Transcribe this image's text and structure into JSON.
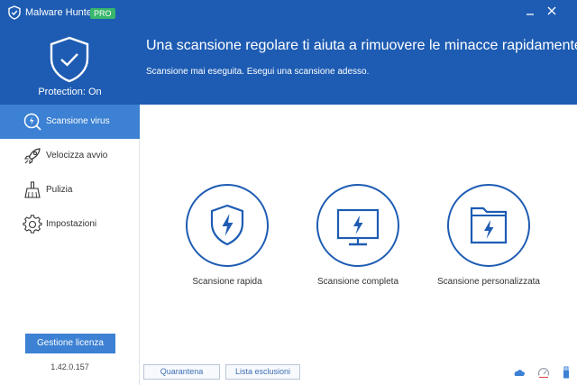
{
  "app": {
    "title": "Malware Hunter",
    "badge": "PRO",
    "logo_icon": "shield-logo-icon",
    "accent_color": "#1e5cb3",
    "badge_color": "#38b66b"
  },
  "window": {
    "minimize_icon": "minimize-icon",
    "close_icon": "close-icon"
  },
  "header": {
    "protection_status": "Protection: On",
    "headline": "Una scansione regolare ti aiuta a rimuovere le minacce rapidamente.",
    "subline": "Scansione mai eseguita. Esegui una scansione adesso."
  },
  "sidebar": {
    "items": [
      {
        "label": "Scansione virus",
        "icon": "scan-virus-icon",
        "active": true
      },
      {
        "label": "Velocizza avvio",
        "icon": "rocket-icon",
        "active": false
      },
      {
        "label": "Pulizia",
        "icon": "broom-icon",
        "active": false
      },
      {
        "label": "Impostazioni",
        "icon": "gear-icon",
        "active": false
      }
    ],
    "license_button": "Gestione licenza",
    "version": "1.42.0.157"
  },
  "scan_options": [
    {
      "label": "Scansione rapida",
      "icon": "shield-lightning-icon"
    },
    {
      "label": "Scansione completa",
      "icon": "monitor-lightning-icon"
    },
    {
      "label": "Scansione personalizzata",
      "icon": "folder-lightning-icon"
    }
  ],
  "footer": {
    "quarantine_button": "Quarantena",
    "exclusions_button": "Lista esclusioni",
    "status_icons": [
      "cloud-icon",
      "speed-gauge-icon",
      "usb-icon"
    ]
  }
}
